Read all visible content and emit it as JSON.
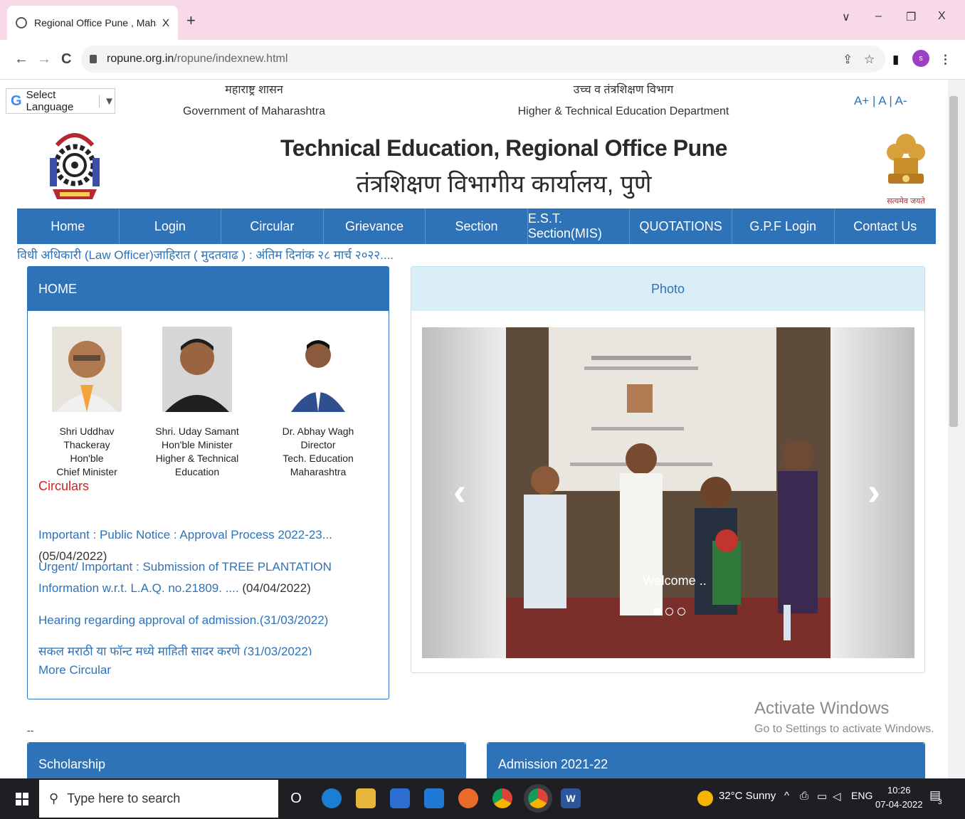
{
  "browser": {
    "tab_title": "Regional Office Pune , Maharashtra",
    "tab_close": "X",
    "new_tab": "+",
    "win_chevron": "∨",
    "win_min": "–",
    "win_restore": "❐",
    "win_close": "X",
    "back": "←",
    "forward": "→",
    "reload": "C",
    "url_host": "ropune.org.in",
    "url_path": "/ropune/indexnew.html",
    "share": "⇪",
    "star": "☆",
    "sidepanel": "▮",
    "profile_initial": "s",
    "menu": "⋮"
  },
  "topbar": {
    "language_label": "Select Language",
    "language_arrow": "▼",
    "gov_marathi": "महाराष्ट्र शासन",
    "gov_english": "Government of Maharashtra",
    "dept_marathi": "उच्च व तंत्रशिक्षण विभाग",
    "dept_english": "Higher & Technical Education Department",
    "font_size_controls": "A+ | A | A-"
  },
  "header": {
    "title": "Technical Education, Regional Office Pune",
    "subtitle": "तंत्रशिक्षण विभागीय कार्यालय, पुणे",
    "emblem_motto": "सत्यमेव जयते"
  },
  "nav": [
    "Home",
    "Login",
    "Circular",
    "Grievance",
    "Section",
    "E.S.T. Section(MIS)",
    "QUOTATIONS",
    "G.P.F Login",
    "Contact Us"
  ],
  "ticker": "विधी अधिकारी (Law Officer)जाहिरात ( मुदतवाढ ) : अंतिम दिनांक २८ मार्च २०२२....",
  "home_panel": {
    "heading": "HOME",
    "persons": [
      {
        "name": "Shri Uddhav Thackeray",
        "line2": "Hon'ble",
        "line3": "Chief Minister"
      },
      {
        "name": "Shri. Uday Samant",
        "line2": "Hon'ble Minister",
        "line3": "Higher & Technical Education"
      },
      {
        "name": "Dr. Abhay Wagh",
        "line2": "Director",
        "line3": "Tech. Education Maharashtra"
      }
    ],
    "circulars_title": "Circulars",
    "circulars": [
      {
        "link": "Important : Public Notice : Approval Process 2022-23...",
        "date": " (05/04/2022)"
      },
      {
        "link": "Urgent/ Important : Submission of TREE PLANTATION Information w.r.t. L.A.Q. no.21809. ....",
        "date": " (04/04/2022)"
      },
      {
        "link": "Hearing regarding approval of admission.",
        "date": "(31/03/2022)"
      },
      {
        "link": "सकल मराठी या फॉन्ट मध्ये माहिती सादर करणे",
        "date": " (31/03/2022)"
      }
    ],
    "more_circular": "More Circular"
  },
  "photo_panel": {
    "heading": "Photo",
    "caption": "Welcome ..",
    "prev": "‹",
    "next": "›",
    "slide_count": 3,
    "active_slide": 1
  },
  "separator": "--",
  "watermark": {
    "line1": "Activate Windows",
    "line2": "Go to Settings to activate Windows."
  },
  "bottom_panels": [
    "Scholarship",
    "Admission 2021-22"
  ],
  "taskbar": {
    "search_placeholder": "Type here to search",
    "cortana": "O",
    "weather": "32°C  Sunny",
    "tray_arrow": "^",
    "language": "ENG",
    "time": "10:26",
    "date": "07-04-2022",
    "notifications": "3"
  },
  "colors": {
    "nav_blue": "#2e72b8",
    "tab_strip": "#f7d9e8",
    "circulars_red": "#d61f1f"
  }
}
